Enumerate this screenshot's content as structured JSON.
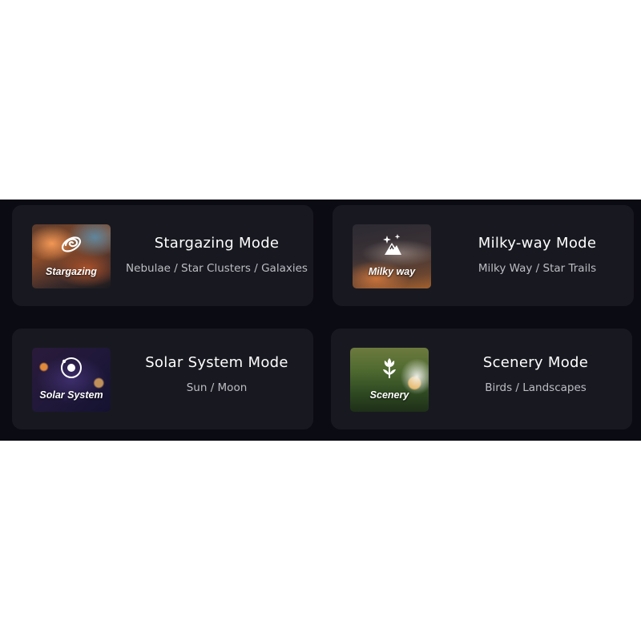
{
  "modes": [
    {
      "title": "Stargazing Mode",
      "subtitle": "Nebulae / Star Clusters / Galaxies",
      "thumb_label": "Stargazing",
      "icon": "galaxy-icon"
    },
    {
      "title": "Milky-way Mode",
      "subtitle": "Milky Way / Star Trails",
      "thumb_label": "Milky way",
      "icon": "stars-mountain-icon"
    },
    {
      "title": "Solar System Mode",
      "subtitle": "Sun / Moon",
      "thumb_label": "Solar System",
      "icon": "planet-orbit-icon"
    },
    {
      "title": "Scenery Mode",
      "subtitle": "Birds / Landscapes",
      "thumb_label": "Scenery",
      "icon": "flower-icon"
    }
  ],
  "colors": {
    "panel_background": "#0b0b13",
    "card_background": "#181920",
    "title_text": "#ffffff",
    "subtitle_text": "#bdbdc4"
  }
}
